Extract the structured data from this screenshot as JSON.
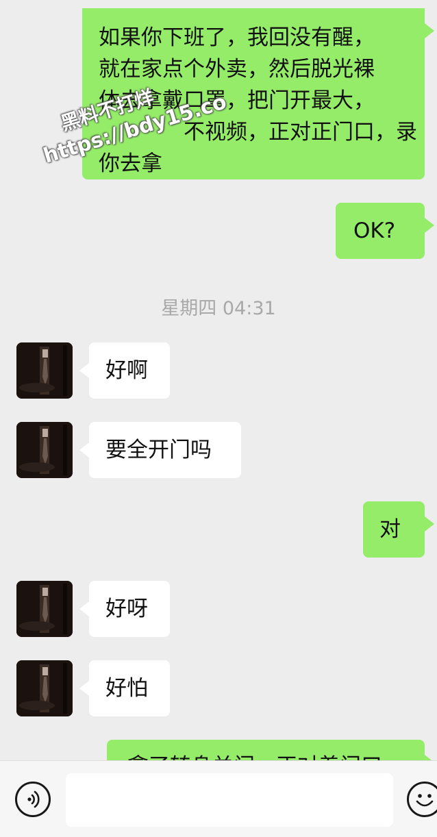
{
  "watermark": {
    "line1": "黑料不打烊",
    "line2": "https://bdy15.co"
  },
  "messages": [
    {
      "from": "me",
      "lines": [
        "如果你下班了，我回没有醒，",
        "就在家点个外卖，然后脱光裸",
        "体去拿戴口罩，把门开最大，",
        "不视频，正对正门口，录",
        "你去拿"
      ]
    },
    {
      "from": "me",
      "text": "OK?"
    },
    {
      "timestamp": "星期四 04:31"
    },
    {
      "from": "them",
      "text": "好啊"
    },
    {
      "from": "them",
      "text": "要全开门吗"
    },
    {
      "from": "me",
      "text": "对"
    },
    {
      "from": "them",
      "text": "好呀"
    },
    {
      "from": "them",
      "text": "好怕"
    },
    {
      "from": "me",
      "lines": [
        "拿了转身关门，正对着门口"
      ]
    }
  ],
  "icons": {
    "voice": "voice-wave-icon",
    "emoji": "smile-emoji-icon"
  },
  "colors": {
    "background": "#ededed",
    "my_bubble": "#95ec69",
    "their_bubble": "#ffffff",
    "timestamp_text": "#a8a8a8"
  }
}
